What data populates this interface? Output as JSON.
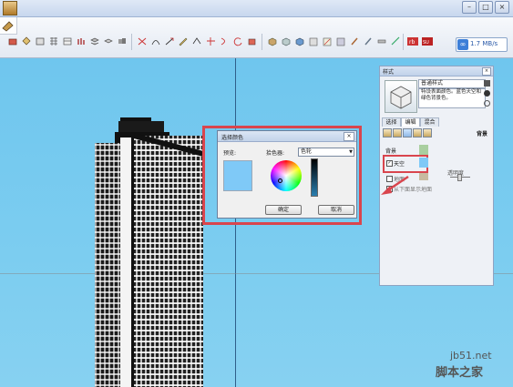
{
  "network": {
    "speed": "1.7 MB/s"
  },
  "dialog": {
    "title": "选择颜色",
    "preview_label": "预览:",
    "picker_label": "拾色器:",
    "picker_value": "色轮",
    "ok": "确定",
    "cancel": "取消",
    "preview_color": "#7fc9f7"
  },
  "styles_panel": {
    "title": "样式",
    "style_name": "普通样式",
    "style_desc": "特设表面颜色。蓝色天空和绿色背景色。",
    "tabs": [
      "选择",
      "编辑",
      "混合"
    ],
    "background_tab": "背景",
    "background_label": "背景",
    "sky_label": "天空",
    "ground_label": "地面",
    "transparency_label": "透明度",
    "show_ground_label": "从下面显示地面",
    "sky_color": "#7fc9f7",
    "background_color": "#a9cfa0",
    "ground_color": "#c8bba0"
  },
  "watermark": {
    "site": "jb51.net",
    "brand": "脚本之家"
  },
  "colors": {
    "highlight": "#d9454d",
    "sky": "#78caef"
  }
}
